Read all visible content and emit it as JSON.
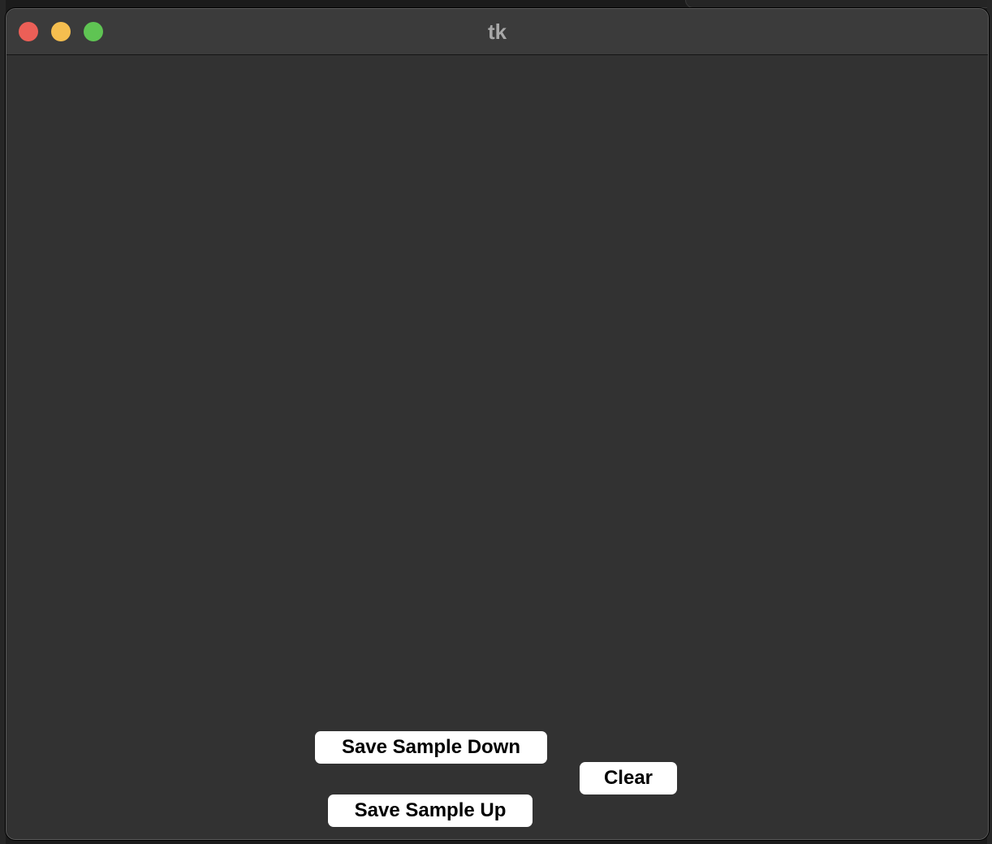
{
  "window": {
    "title": "tk",
    "controls": {
      "close_icon": "close-icon",
      "minimize_icon": "minimize-icon",
      "zoom_icon": "zoom-icon"
    }
  },
  "buttons": {
    "save_sample_down": "Save Sample Down",
    "clear": "Clear",
    "save_sample_up": "Save Sample Up"
  },
  "colors": {
    "close": "#ec5f57",
    "minimize": "#f5be4f",
    "zoom": "#5fc453",
    "window_bg": "#323232",
    "titlebar_bg": "#3b3b3b",
    "button_bg": "#ffffff"
  }
}
